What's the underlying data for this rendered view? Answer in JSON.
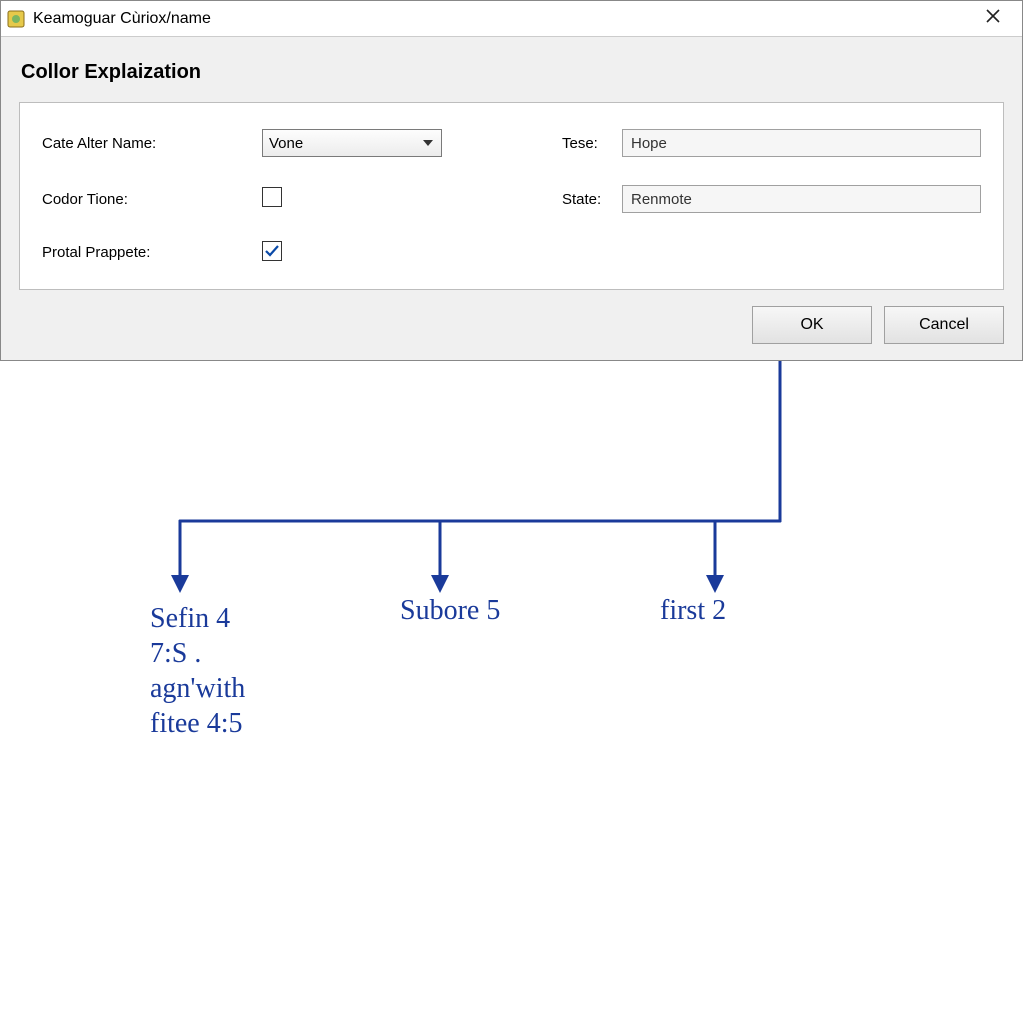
{
  "window": {
    "title": "Keamoguar Cùriox/name"
  },
  "dialog": {
    "heading": "Collor Explaization",
    "form": {
      "cate_alter_name_label": "Cate Alter Name:",
      "cate_alter_name_value": "Vone",
      "codor_tione_label": "Codor Tione:",
      "codor_tione_checked": false,
      "protal_prappete_label": "Protal Prappete:",
      "protal_prappete_checked": true,
      "tese_label": "Tese:",
      "tese_value": "Hope",
      "state_label": "State:",
      "state_value": "Renmote"
    },
    "buttons": {
      "ok": "OK",
      "cancel": "Cancel"
    }
  },
  "annotations": {
    "branch1": "Sefin 4\n7:S .\nagn'with\nfitee 4:5",
    "branch2": "Subore 5",
    "branch3": "first 2"
  }
}
